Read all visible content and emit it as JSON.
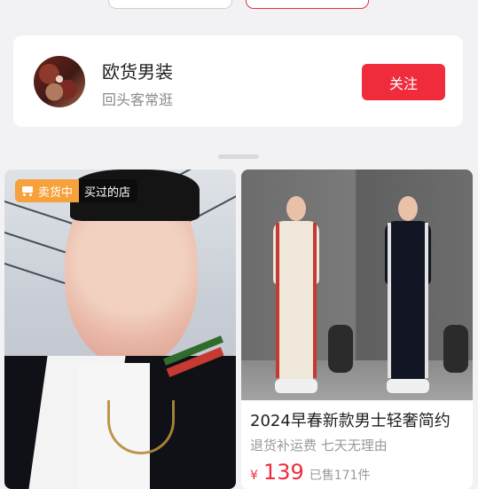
{
  "store": {
    "name": "欧货男装",
    "subtitle": "回头客常逛",
    "follow_label": "关注"
  },
  "cards": {
    "left": {
      "badge_primary": "卖货中",
      "badge_secondary": "买过的店"
    },
    "right": {
      "title": "2024早春新款男士轻奢简约",
      "subtitle": "退货补运费 七天无理由",
      "price_symbol": "¥",
      "price": "139",
      "sold": "已售171件"
    }
  },
  "colors": {
    "accent_red": "#f02b3c",
    "badge_orange": "#f6a13b"
  },
  "icons": {
    "cart": "shopping-cart-icon"
  }
}
